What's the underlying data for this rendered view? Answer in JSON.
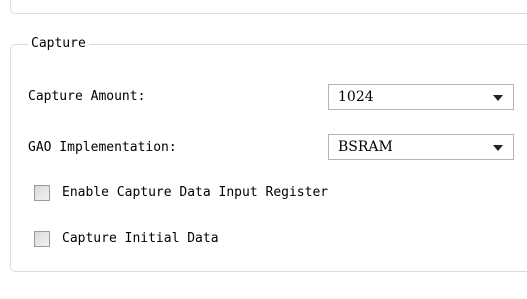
{
  "capture_group": {
    "title": "Capture",
    "capture_amount": {
      "label": "Capture Amount:",
      "value": "1024"
    },
    "gao_implementation": {
      "label": "GAO Implementation:",
      "value": "BSRAM"
    },
    "enable_capture_input_register": {
      "label": "Enable Capture Data Input Register",
      "checked": false
    },
    "capture_initial_data": {
      "label": "Capture Initial Data",
      "checked": false
    }
  },
  "icons": {
    "dropdown": "chevron-down-icon",
    "checkbox": "checkbox-icon"
  },
  "colors": {
    "border": "#dcdcdc",
    "combo_border": "#b4b4b4",
    "text": "#000000"
  }
}
